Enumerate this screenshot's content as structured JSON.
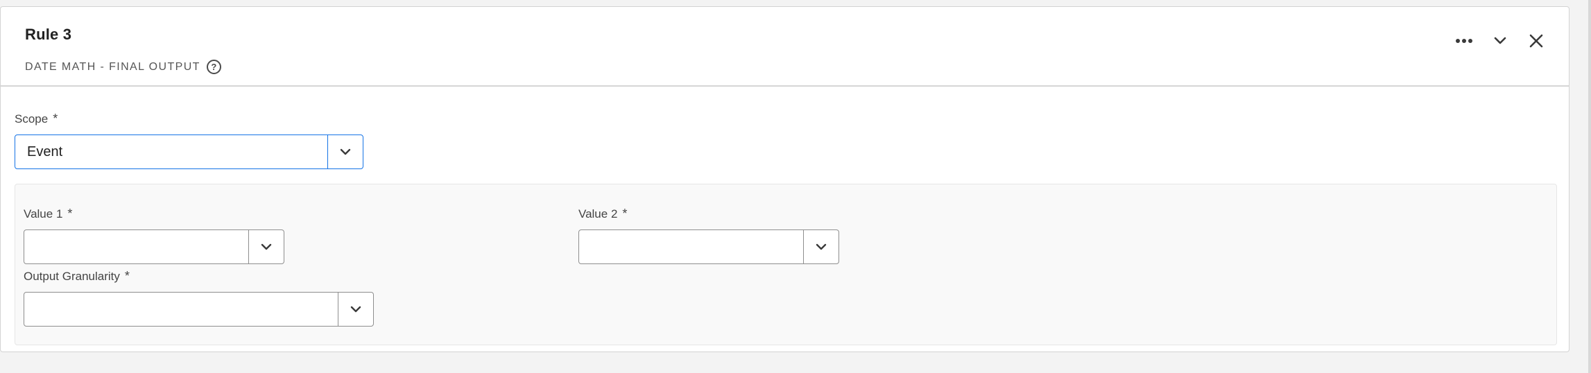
{
  "rule": {
    "title": "Rule 3",
    "subtitle": "DATE MATH - FINAL OUTPUT",
    "help_icon": "help-circle-icon"
  },
  "header_actions": {
    "more_icon": "more-horizontal-icon",
    "collapse_icon": "chevron-down-icon",
    "close_icon": "close-icon"
  },
  "scope": {
    "label": "Scope",
    "required_mark": "*",
    "value": "Event"
  },
  "value1": {
    "label": "Value 1",
    "required_mark": "*",
    "value": ""
  },
  "value2": {
    "label": "Value 2",
    "required_mark": "*",
    "value": ""
  },
  "output_granularity": {
    "label": "Output Granularity",
    "required_mark": "*",
    "value": ""
  },
  "colors": {
    "focus_border": "#1473e6",
    "panel_background": "#f9f9f9",
    "page_background": "#f3f3f3"
  }
}
